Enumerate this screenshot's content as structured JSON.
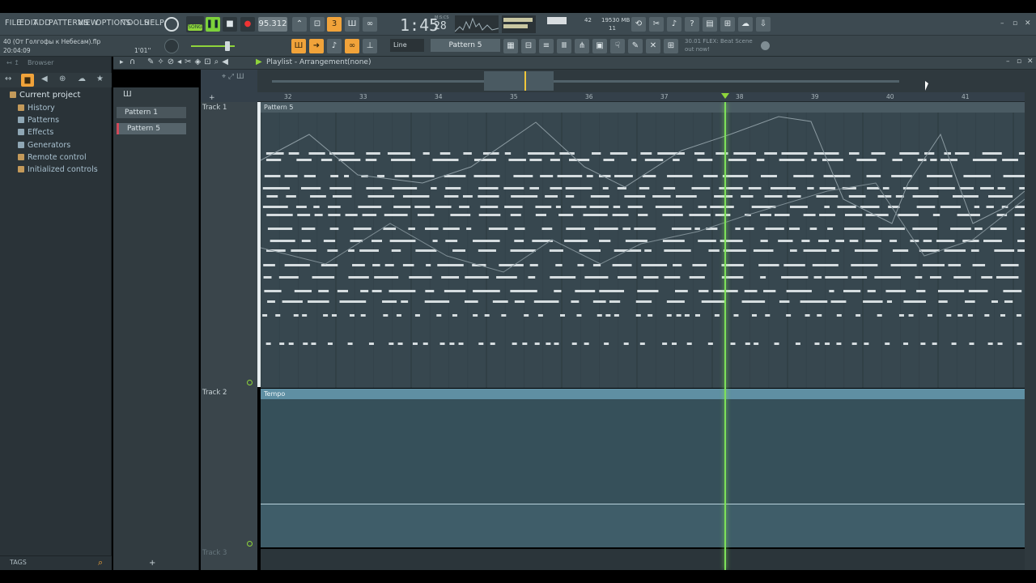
{
  "menu": [
    "FILE",
    "EDIT",
    "ADD",
    "PATTERNS",
    "VIEW",
    "OPTIONS",
    "TOOLS",
    "HELP"
  ],
  "transport": {
    "mode_label": "SONG",
    "tempo": "95.312",
    "time_main": "1:45",
    "time_sub": "28",
    "time_unit": "M:S:CS",
    "cpu": "42",
    "memory": "19530 MB",
    "voices": "11"
  },
  "project": {
    "filename": "40 (От Голгофы к Небесам).flp",
    "time": "20:04:09",
    "length": "1'01''"
  },
  "toolbar2": {
    "snap": "Line",
    "pattern": "Pattern 5",
    "news_line1": "30.01  FLEX: Beat Scene",
    "news_line2": "out now!"
  },
  "browser": {
    "title": "Browser",
    "root": "Current project",
    "items": [
      "History",
      "Patterns",
      "Effects",
      "Generators",
      "Remote control",
      "Initialized controls"
    ],
    "tags_label": "TAGS"
  },
  "playlist": {
    "title": "Playlist - Arrangement",
    "arrangement": "(none)",
    "ruler_numbers": [
      "32",
      "33",
      "34",
      "35",
      "36",
      "37",
      "38",
      "39",
      "40",
      "41"
    ],
    "tracks": [
      {
        "label": "Track 1",
        "clip": "Pattern 5"
      },
      {
        "label": "Track 2",
        "clip": "Tempo"
      },
      {
        "label": "Track 3",
        "clip": ""
      }
    ]
  },
  "picker": {
    "patterns": [
      "Pattern 1",
      "Pattern 5"
    ]
  },
  "colors": {
    "accent": "#f1a33a",
    "playhead": "#7ee05a",
    "grid_bg": "#37474f"
  }
}
